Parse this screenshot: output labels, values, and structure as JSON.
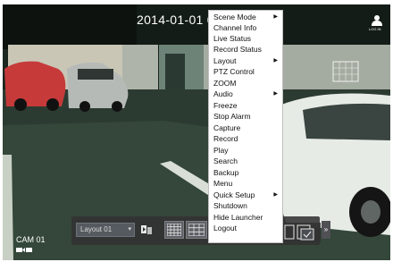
{
  "overlay": {
    "datetime": "2014-01-01 0",
    "user_label": "LOG IN",
    "camera_name": "CAM 01"
  },
  "launcher": {
    "layout_value": "Layout 01",
    "expand_glyph": "»"
  },
  "context_menu": {
    "items": [
      {
        "label": "Scene Mode",
        "submenu": true
      },
      {
        "label": "Channel Info",
        "submenu": false
      },
      {
        "label": "Live Status",
        "submenu": false
      },
      {
        "label": "Record Status",
        "submenu": false
      },
      {
        "label": "Layout",
        "submenu": true
      },
      {
        "label": "PTZ Control",
        "submenu": false
      },
      {
        "label": "ZOOM",
        "submenu": false
      },
      {
        "label": "Audio",
        "submenu": true
      },
      {
        "label": "Freeze",
        "submenu": false
      },
      {
        "label": "Stop Alarm",
        "submenu": false
      },
      {
        "label": "Capture",
        "submenu": false
      },
      {
        "label": "Record",
        "submenu": false
      },
      {
        "label": "Play",
        "submenu": false
      },
      {
        "label": "Search",
        "submenu": false
      },
      {
        "label": "Backup",
        "submenu": false
      },
      {
        "label": "Menu",
        "submenu": false
      },
      {
        "label": "Quick Setup",
        "submenu": true
      },
      {
        "label": "Shutdown",
        "submenu": false
      },
      {
        "label": "Hide Launcher",
        "submenu": false
      },
      {
        "label": "Logout",
        "submenu": false
      }
    ],
    "submenu_arrow": "▶"
  }
}
